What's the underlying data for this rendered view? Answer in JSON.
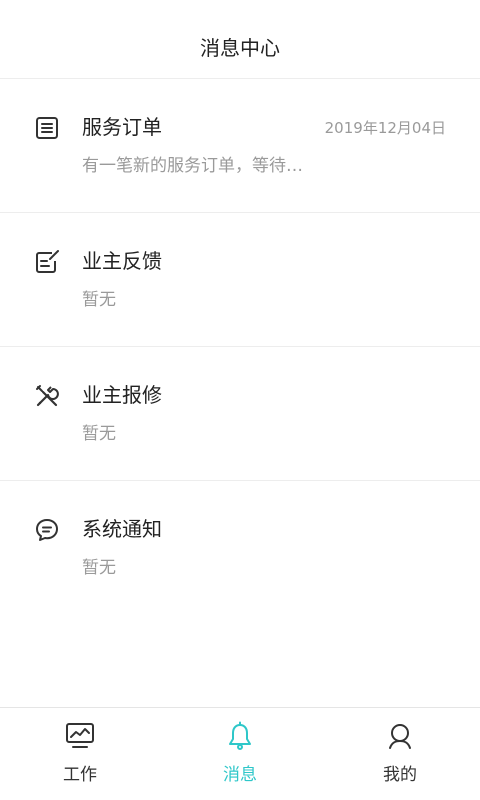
{
  "header": {
    "title": "消息中心"
  },
  "messages": [
    {
      "icon": "order-list-icon",
      "title": "服务订单",
      "date": "2019年12月04日",
      "preview": "有一笔新的服务订单，等待…"
    },
    {
      "icon": "feedback-edit-icon",
      "title": "业主反馈",
      "date": "",
      "preview": "暂无"
    },
    {
      "icon": "repair-tools-icon",
      "title": "业主报修",
      "date": "",
      "preview": "暂无"
    },
    {
      "icon": "chat-bubble-icon",
      "title": "系统通知",
      "date": "",
      "preview": "暂无"
    }
  ],
  "tabbar": {
    "active_color": "#2ec7c9",
    "tabs": [
      {
        "icon": "monitor-chart-icon",
        "label": "工作"
      },
      {
        "icon": "bell-icon",
        "label": "消息"
      },
      {
        "icon": "user-icon",
        "label": "我的"
      }
    ]
  }
}
